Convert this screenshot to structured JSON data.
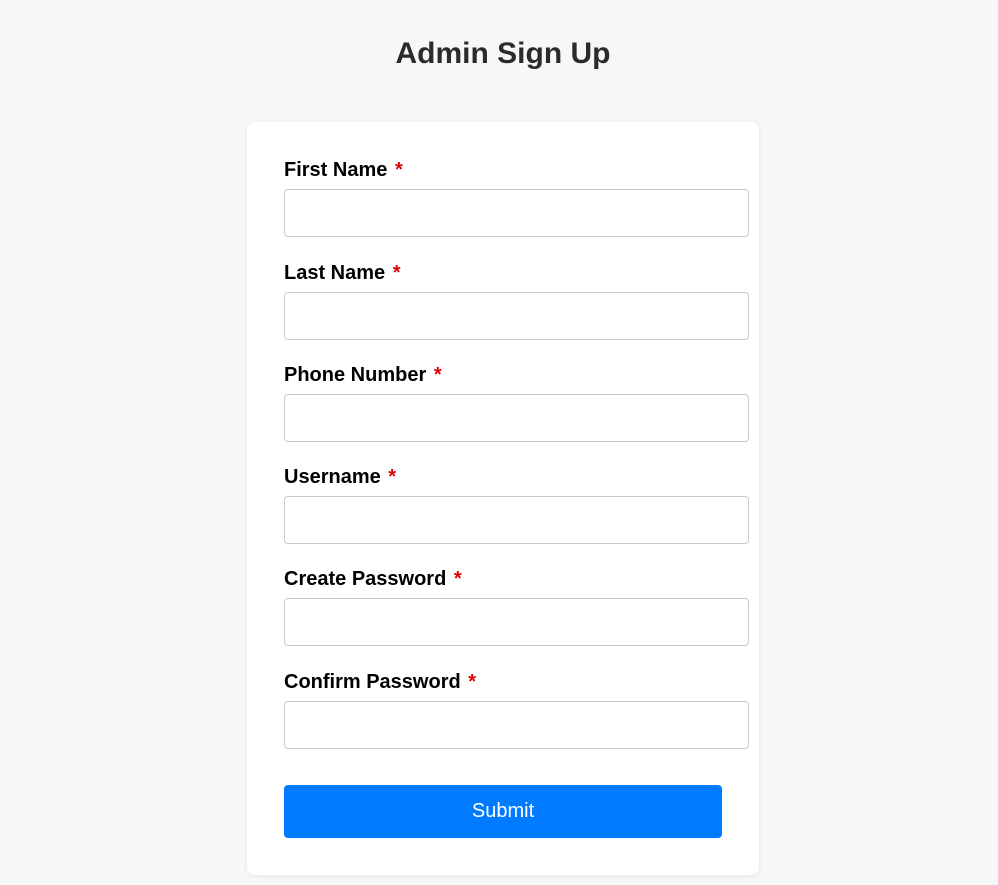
{
  "page": {
    "title": "Admin Sign Up",
    "background_color": "#f6f7f9"
  },
  "form": {
    "required_marker": "*",
    "required_color": "#e00000",
    "fields": [
      {
        "label": "First Name",
        "value": "",
        "placeholder": ""
      },
      {
        "label": "Last Name",
        "value": "",
        "placeholder": ""
      },
      {
        "label": "Phone Number",
        "value": "",
        "placeholder": ""
      },
      {
        "label": "Username",
        "value": "",
        "placeholder": ""
      },
      {
        "label": "Create Password",
        "value": "",
        "placeholder": ""
      },
      {
        "label": "Confirm Password",
        "value": "",
        "placeholder": ""
      }
    ],
    "submit_label": "Submit",
    "submit_color": "#007bff"
  }
}
